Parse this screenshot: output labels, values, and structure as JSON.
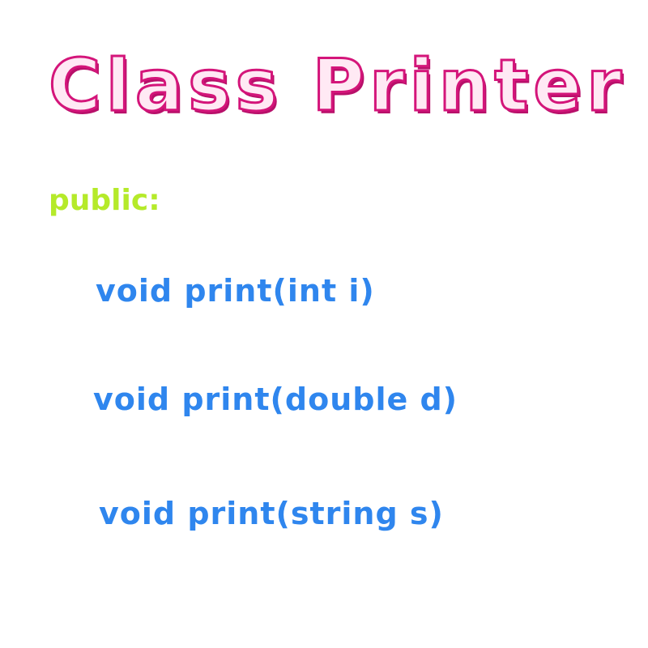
{
  "title": "Class Printer",
  "access_specifier": "public:",
  "methods": [
    "void print(int i)",
    "void print(double d)",
    "void print(string s)"
  ],
  "colors": {
    "title_fill": "#ffe9f4",
    "title_outline": "#d4157a",
    "access_specifier": "#b5ea2a",
    "methods": "#2f86ee",
    "background": "#ffffff"
  }
}
